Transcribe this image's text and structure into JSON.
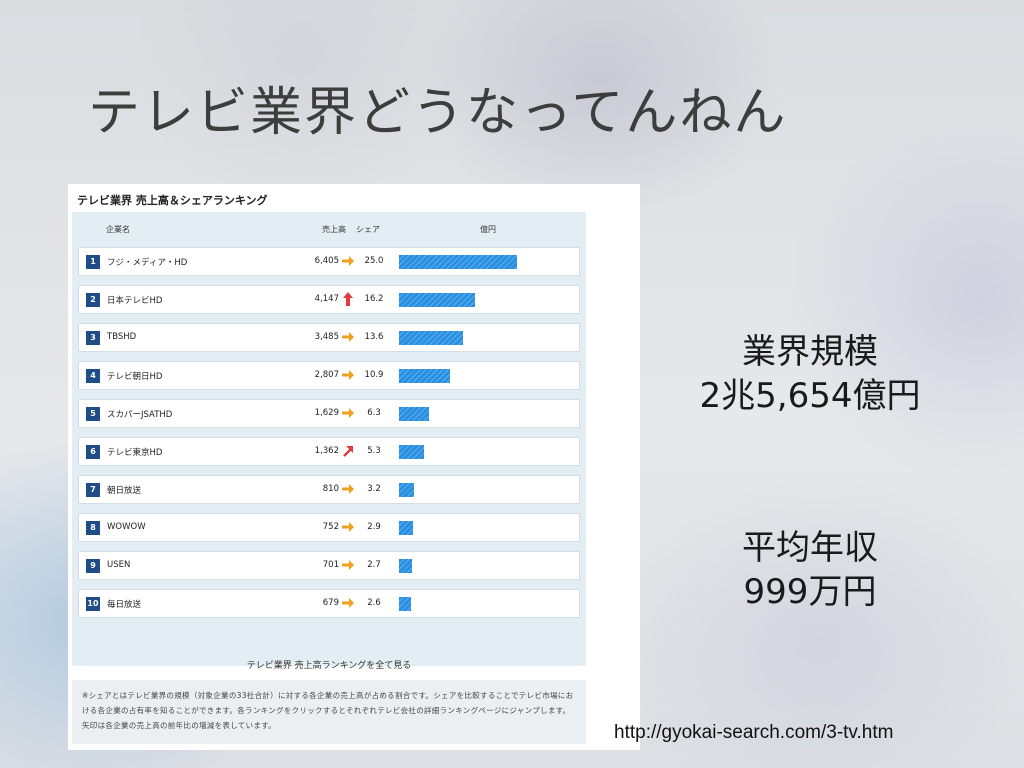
{
  "slide": {
    "title": "テレビ業界どうなってんねん",
    "stats": {
      "industry_scale_label": "業界規模",
      "industry_scale_value": "2兆5,654億円",
      "avg_salary_label": "平均年収",
      "avg_salary_value": "999万円"
    },
    "source_url": "http://gyokai-search.com/3-tv.htm"
  },
  "ranking": {
    "title": "テレビ業界 売上高＆シェアランキング",
    "headers": {
      "company": "企業名",
      "sales": "売上高",
      "share": "シェア",
      "bar": "億円"
    },
    "trend_colors": {
      "flat": "#f0a020",
      "up": "#e23b3b"
    },
    "bar_color": "#2b8fe0",
    "rows": [
      {
        "rank": "1",
        "name": "フジ・メディア・HD",
        "sales": "6,405",
        "trend": "flat",
        "share": "25.0",
        "share_value": 25.0
      },
      {
        "rank": "2",
        "name": "日本テレビHD",
        "sales": "4,147",
        "trend": "up",
        "share": "16.2",
        "share_value": 16.2
      },
      {
        "rank": "3",
        "name": "TBSHD",
        "sales": "3,485",
        "trend": "flat",
        "share": "13.6",
        "share_value": 13.6
      },
      {
        "rank": "4",
        "name": "テレビ朝日HD",
        "sales": "2,807",
        "trend": "flat",
        "share": "10.9",
        "share_value": 10.9
      },
      {
        "rank": "5",
        "name": "スカパーJSATHD",
        "sales": "1,629",
        "trend": "flat",
        "share": "6.3",
        "share_value": 6.3
      },
      {
        "rank": "6",
        "name": "テレビ東京HD",
        "sales": "1,362",
        "trend": "up-right",
        "share": "5.3",
        "share_value": 5.3
      },
      {
        "rank": "7",
        "name": "朝日放送",
        "sales": "810",
        "trend": "flat",
        "share": "3.2",
        "share_value": 3.2
      },
      {
        "rank": "8",
        "name": "WOWOW",
        "sales": "752",
        "trend": "flat",
        "share": "2.9",
        "share_value": 2.9
      },
      {
        "rank": "9",
        "name": "USEN",
        "sales": "701",
        "trend": "flat",
        "share": "2.7",
        "share_value": 2.7
      },
      {
        "rank": "10",
        "name": "毎日放送",
        "sales": "679",
        "trend": "flat",
        "share": "2.6",
        "share_value": 2.6
      }
    ],
    "more_link": "テレビ業界 売上高ランキングを全て見る",
    "note": "※シェアとはテレビ業界の規模（対象企業の33社合計）に対する各企業の売上高が占める割合です。シェアを比較することでテレビ市場における各企業の占有率を知ることができます。各ランキングをクリックするとそれぞれテレビ会社の詳細ランキングページにジャンプします。矢印は各企業の売上高の前年比の増減を表しています。"
  }
}
